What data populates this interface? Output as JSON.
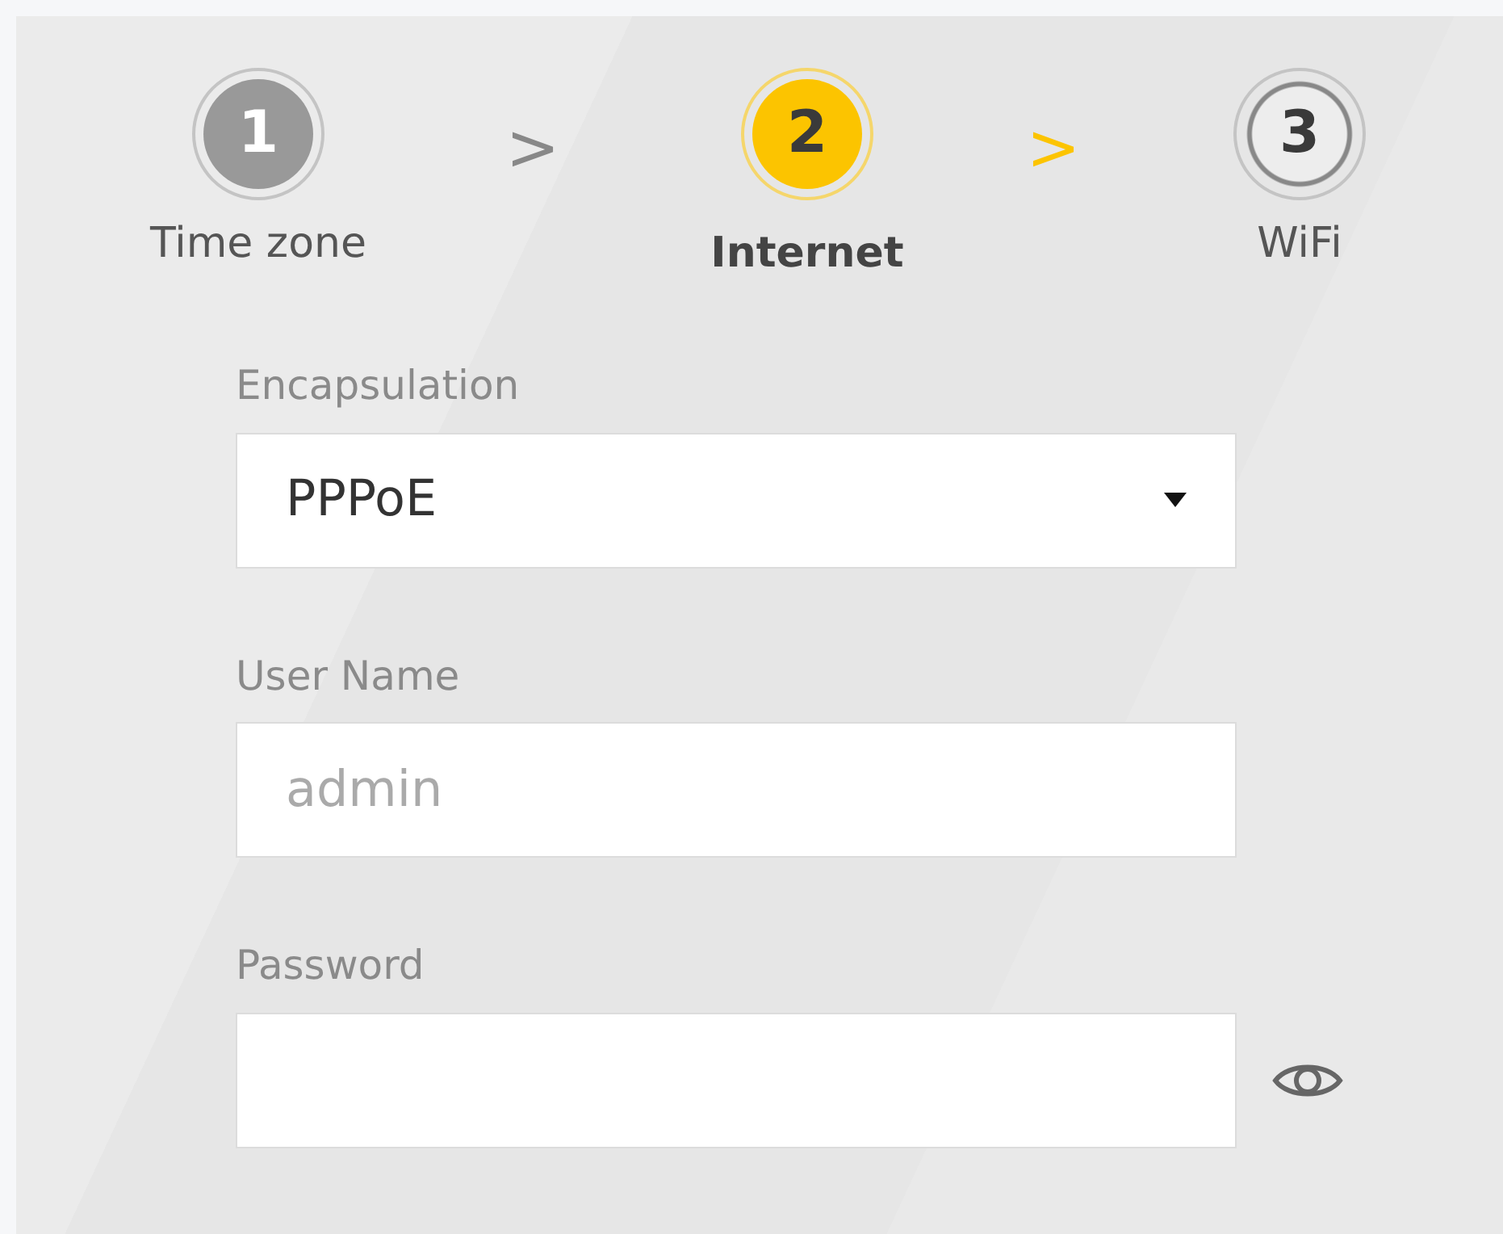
{
  "steps": [
    {
      "number": "1",
      "label": "Time zone",
      "kind": "done"
    },
    {
      "separator": ">",
      "separator_highlighted": false,
      "number": "2",
      "label": "Internet",
      "kind": "current"
    },
    {
      "separator": ">",
      "separator_highlighted": true,
      "number": "3",
      "label": "WiFi",
      "kind": "upcoming"
    }
  ],
  "form": {
    "encapsulation": {
      "label": "Encapsulation",
      "value": "PPPoE"
    },
    "user_name": {
      "label": "User Name",
      "placeholder": "admin"
    },
    "password": {
      "label": "Password"
    }
  }
}
